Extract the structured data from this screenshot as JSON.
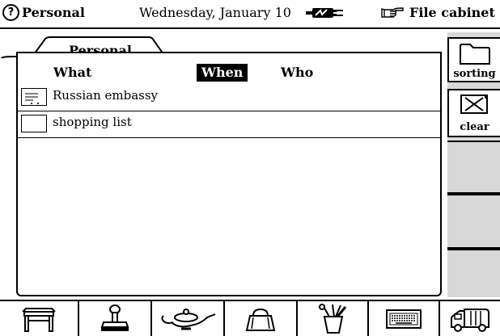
{
  "topbar": {
    "help_glyph": "?",
    "title": "Personal",
    "date": "Wednesday, January 10",
    "file_cabinet": "File cabinet"
  },
  "folder": {
    "tab_label": "Personal",
    "columns": {
      "what": "What",
      "when": "When",
      "who": "Who"
    },
    "active_column": "When",
    "items": [
      {
        "label": "Russian embassy",
        "icon": "note-icon"
      },
      {
        "label": "shopping list",
        "icon": "blank-note-icon"
      }
    ]
  },
  "sidebar": {
    "sorting_label": "sorting",
    "clear_label": "clear"
  },
  "bottombar": {
    "icons": [
      "desk-icon",
      "stamp-icon",
      "lamp-icon",
      "purse-icon",
      "tools-icon",
      "keyboard-icon",
      "truck-icon"
    ]
  }
}
